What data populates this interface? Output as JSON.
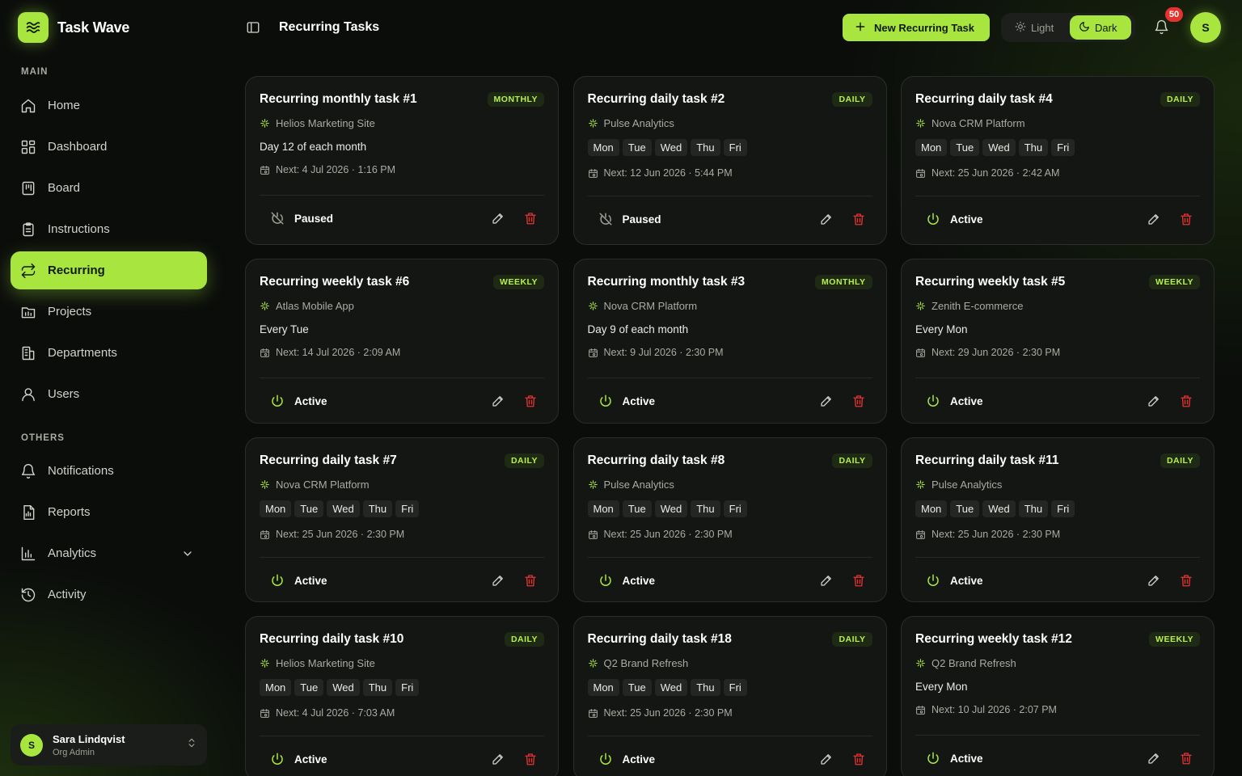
{
  "app": {
    "name": "Task Wave"
  },
  "sidebar": {
    "main_label": "MAIN",
    "others_label": "OTHERS",
    "main_items": [
      {
        "label": "Home",
        "icon": "home-icon"
      },
      {
        "label": "Dashboard",
        "icon": "dashboard-icon"
      },
      {
        "label": "Board",
        "icon": "board-icon"
      },
      {
        "label": "Instructions",
        "icon": "clipboard-icon"
      },
      {
        "label": "Recurring",
        "icon": "repeat-icon",
        "active": true
      },
      {
        "label": "Projects",
        "icon": "projects-icon"
      },
      {
        "label": "Departments",
        "icon": "building-icon"
      },
      {
        "label": "Users",
        "icon": "user-icon"
      }
    ],
    "other_items": [
      {
        "label": "Notifications",
        "icon": "bell-icon"
      },
      {
        "label": "Reports",
        "icon": "report-icon"
      },
      {
        "label": "Analytics",
        "icon": "chart-icon",
        "expandable": true
      },
      {
        "label": "Activity",
        "icon": "history-icon"
      }
    ],
    "user": {
      "initial": "S",
      "name": "Sara Lindqvist",
      "role": "Org Admin"
    }
  },
  "header": {
    "title": "Recurring Tasks",
    "new_button": "New Recurring Task",
    "theme_light": "Light",
    "theme_dark": "Dark",
    "notification_count": "50",
    "avatar_initial": "S"
  },
  "colors": {
    "accent": "#a8e63f",
    "danger": "#e5322f",
    "background": "#0b0d0b",
    "card": "#141614"
  },
  "tasks": [
    {
      "title": "Recurring monthly task #1",
      "frequency": "MONTHLY",
      "project": "Helios Marketing Site",
      "schedule": "Day 12 of each month",
      "next": "Next: 4 Jul 2026 · 1:16 PM",
      "status": "Paused"
    },
    {
      "title": "Recurring daily task #2",
      "frequency": "DAILY",
      "project": "Pulse Analytics",
      "days": [
        "Mon",
        "Tue",
        "Wed",
        "Thu",
        "Fri"
      ],
      "next": "Next: 12 Jun 2026 · 5:44 PM",
      "status": "Paused"
    },
    {
      "title": "Recurring daily task #4",
      "frequency": "DAILY",
      "project": "Nova CRM Platform",
      "days": [
        "Mon",
        "Tue",
        "Wed",
        "Thu",
        "Fri"
      ],
      "next": "Next: 25 Jun 2026 · 2:42 AM",
      "status": "Active"
    },
    {
      "title": "Recurring weekly task #6",
      "frequency": "WEEKLY",
      "project": "Atlas Mobile App",
      "schedule": "Every Tue",
      "next": "Next: 14 Jul 2026 · 2:09 AM",
      "status": "Active"
    },
    {
      "title": "Recurring monthly task #3",
      "frequency": "MONTHLY",
      "project": "Nova CRM Platform",
      "schedule": "Day 9 of each month",
      "next": "Next: 9 Jul 2026 · 2:30 PM",
      "status": "Active"
    },
    {
      "title": "Recurring weekly task #5",
      "frequency": "WEEKLY",
      "project": "Zenith E-commerce",
      "schedule": "Every Mon",
      "next": "Next: 29 Jun 2026 · 2:30 PM",
      "status": "Active"
    },
    {
      "title": "Recurring daily task #7",
      "frequency": "DAILY",
      "project": "Nova CRM Platform",
      "days": [
        "Mon",
        "Tue",
        "Wed",
        "Thu",
        "Fri"
      ],
      "next": "Next: 25 Jun 2026 · 2:30 PM",
      "status": "Active"
    },
    {
      "title": "Recurring daily task #8",
      "frequency": "DAILY",
      "project": "Pulse Analytics",
      "days": [
        "Mon",
        "Tue",
        "Wed",
        "Thu",
        "Fri"
      ],
      "next": "Next: 25 Jun 2026 · 2:30 PM",
      "status": "Active"
    },
    {
      "title": "Recurring daily task #11",
      "frequency": "DAILY",
      "project": "Pulse Analytics",
      "days": [
        "Mon",
        "Tue",
        "Wed",
        "Thu",
        "Fri"
      ],
      "next": "Next: 25 Jun 2026 · 2:30 PM",
      "status": "Active"
    },
    {
      "title": "Recurring daily task #10",
      "frequency": "DAILY",
      "project": "Helios Marketing Site",
      "days": [
        "Mon",
        "Tue",
        "Wed",
        "Thu",
        "Fri"
      ],
      "next": "Next: 4 Jul 2026 · 7:03 AM",
      "status": "Active"
    },
    {
      "title": "Recurring daily task #18",
      "frequency": "DAILY",
      "project": "Q2 Brand Refresh",
      "days": [
        "Mon",
        "Tue",
        "Wed",
        "Thu",
        "Fri"
      ],
      "next": "Next: 25 Jun 2026 · 2:30 PM",
      "status": "Active"
    },
    {
      "title": "Recurring weekly task #12",
      "frequency": "WEEKLY",
      "project": "Q2 Brand Refresh",
      "schedule": "Every Mon",
      "next": "Next: 10 Jul 2026 · 2:07 PM",
      "status": "Active"
    }
  ]
}
